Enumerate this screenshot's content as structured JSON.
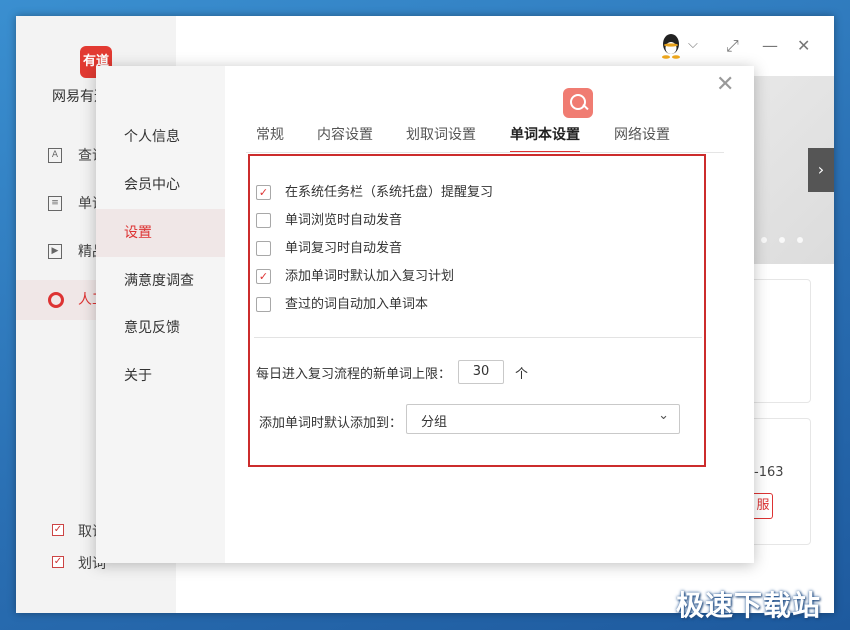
{
  "app": {
    "logo_text": "有道",
    "name": "网易有道",
    "sidebar": [
      {
        "icon": "A",
        "label": "查词"
      },
      {
        "icon": "≡",
        "label": "单词"
      },
      {
        "icon": "▶",
        "label": "精品"
      },
      {
        "icon": "",
        "label": "人工"
      }
    ],
    "bottom_checks": [
      {
        "label": "取词",
        "checked": true
      },
      {
        "label": "划词",
        "checked": true
      }
    ],
    "banner_next": "›",
    "peek_text": "-163",
    "peek_button": "服",
    "window_controls": {
      "dropdown": "⌵",
      "restore": "⤢",
      "minimize": "—",
      "close": "✕"
    }
  },
  "dialog": {
    "nav": [
      "个人信息",
      "会员中心",
      "设置",
      "满意度调查",
      "意见反馈",
      "关于"
    ],
    "active_nav": 2,
    "close": "✕",
    "tabs": [
      "常规",
      "内容设置",
      "划取词设置",
      "单词本设置",
      "网络设置"
    ],
    "active_tab": 3,
    "options": [
      {
        "label": "在系统任务栏（系统托盘）提醒复习",
        "checked": true
      },
      {
        "label": "单词浏览时自动发音",
        "checked": false
      },
      {
        "label": "单词复习时自动发音",
        "checked": false
      },
      {
        "label": "添加单词时默认加入复习计划",
        "checked": true
      },
      {
        "label": "查过的词自动加入单词本",
        "checked": false
      }
    ],
    "check_mark": "✓",
    "daily_limit": {
      "label": "每日进入复习流程的新单词上限：",
      "value": "30",
      "unit": "个"
    },
    "default_group": {
      "label": "添加单词时默认添加到：",
      "value": "分组",
      "chevron": "⌄"
    }
  },
  "watermark": "极速下载站"
}
